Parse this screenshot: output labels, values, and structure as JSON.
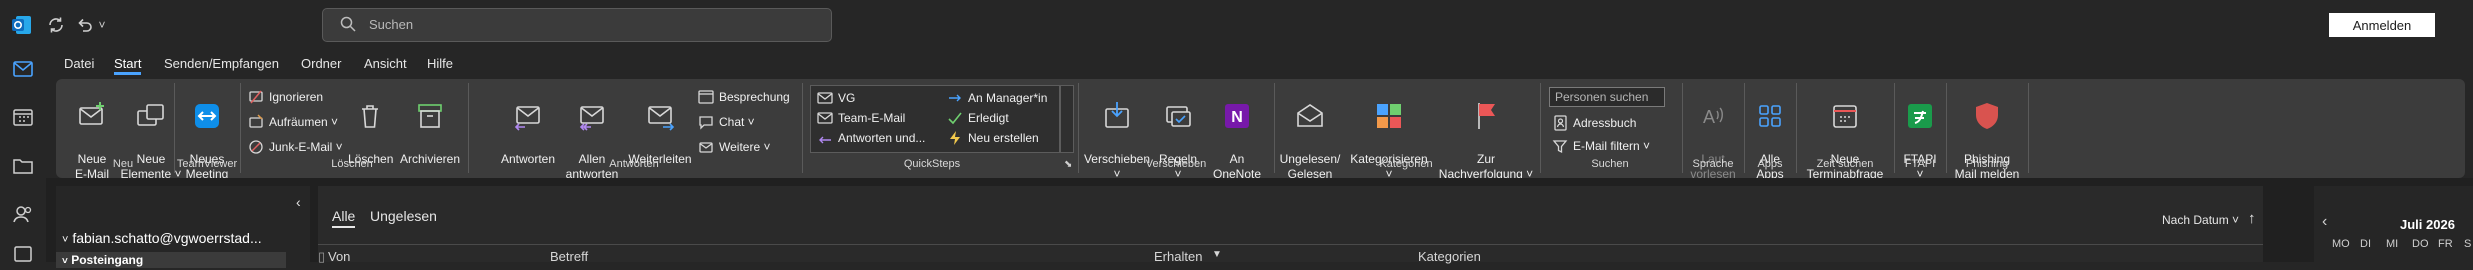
{
  "titlebar": {
    "search_placeholder": "Suchen",
    "signin_label": "Anmelden"
  },
  "menu": {
    "tabs": [
      {
        "label": "Datei"
      },
      {
        "label": "Start",
        "active": true
      },
      {
        "label": "Senden/Empfangen"
      },
      {
        "label": "Ordner"
      },
      {
        "label": "Ansicht"
      },
      {
        "label": "Hilfe"
      }
    ]
  },
  "ribbon": {
    "groups": {
      "neu": "Neu",
      "teamviewer": "TeamViewer",
      "loeschen": "Löschen",
      "antworten": "Antworten",
      "quicksteps": "QuickSteps",
      "verschieben": "Verschieben",
      "kategorien": "Kategorien",
      "suchen": "Suchen",
      "sprache": "Sprache",
      "apps": "Apps",
      "zeit_suchen": "Zeit suchen",
      "ftapi": "FTAPI",
      "phishing": "Phishing"
    },
    "buttons": {
      "neue_email": "Neue\nE-Mail",
      "neue_elemente": "Neue\nElemente ˅",
      "neues_meeting": "Neues\nMeeting",
      "ignorieren": "Ignorieren",
      "aufraeumen": "Aufräumen ˅",
      "junk": "Junk-E-Mail ˅",
      "loeschen": "Löschen",
      "archivieren": "Archivieren",
      "antworten": "Antworten",
      "allen_antworten": "Allen\nantworten",
      "weiterleiten": "Weiterleiten",
      "besprechung": "Besprechung",
      "chat": "Chat ˅",
      "weitere": "Weitere ˅",
      "qs_vg": "VG",
      "qs_team": "Team-E-Mail",
      "qs_antworten": "Antworten und...",
      "qs_manager": "An Manager*in",
      "qs_erledigt": "Erledigt",
      "qs_neu": "Neu erstellen",
      "verschieben": "Verschieben\n˅",
      "regeln": "Regeln\n˅",
      "onenote": "An OneNote\nsenden",
      "ungelesen": "Ungelesen/\nGelesen",
      "kategorisieren": "Kategorisieren\n˅",
      "nachverfolgung": "Zur\nNachverfolgung ˅",
      "personen_placeholder": "Personen suchen",
      "adressbuch": "Adressbuch",
      "email_filtern": "E-Mail filtern ˅",
      "laut_vorlesen": "Laut\nvorlesen",
      "alle_apps": "Alle\nApps",
      "terminabfrage": "Neue\nTerminabfrage",
      "ftapi": "FTAPI\n˅",
      "phishing": "Phishing\nMail melden"
    }
  },
  "folders": {
    "account": "fabian.schatto@vgwoerrstad...",
    "inbox": "Posteingang"
  },
  "maillist": {
    "tabs": [
      {
        "label": "Alle",
        "active": true
      },
      {
        "label": "Ungelesen"
      }
    ],
    "sort_label": "Nach Datum ˅",
    "columns": {
      "from": "Von",
      "subject": "Betreff",
      "received": "Erhalten",
      "categories": "Kategorien"
    }
  },
  "calendar": {
    "month": "Juli 2026",
    "weekdays": [
      "MO",
      "DI",
      "MI",
      "DO",
      "FR",
      "S"
    ]
  },
  "colors": {
    "accent": "#4aa3ff",
    "outlook_blue": "#0f6cbd",
    "onenote_purple": "#7719aa",
    "ftapi_green": "#1a9b4b",
    "phishing_red": "#d9534f"
  }
}
